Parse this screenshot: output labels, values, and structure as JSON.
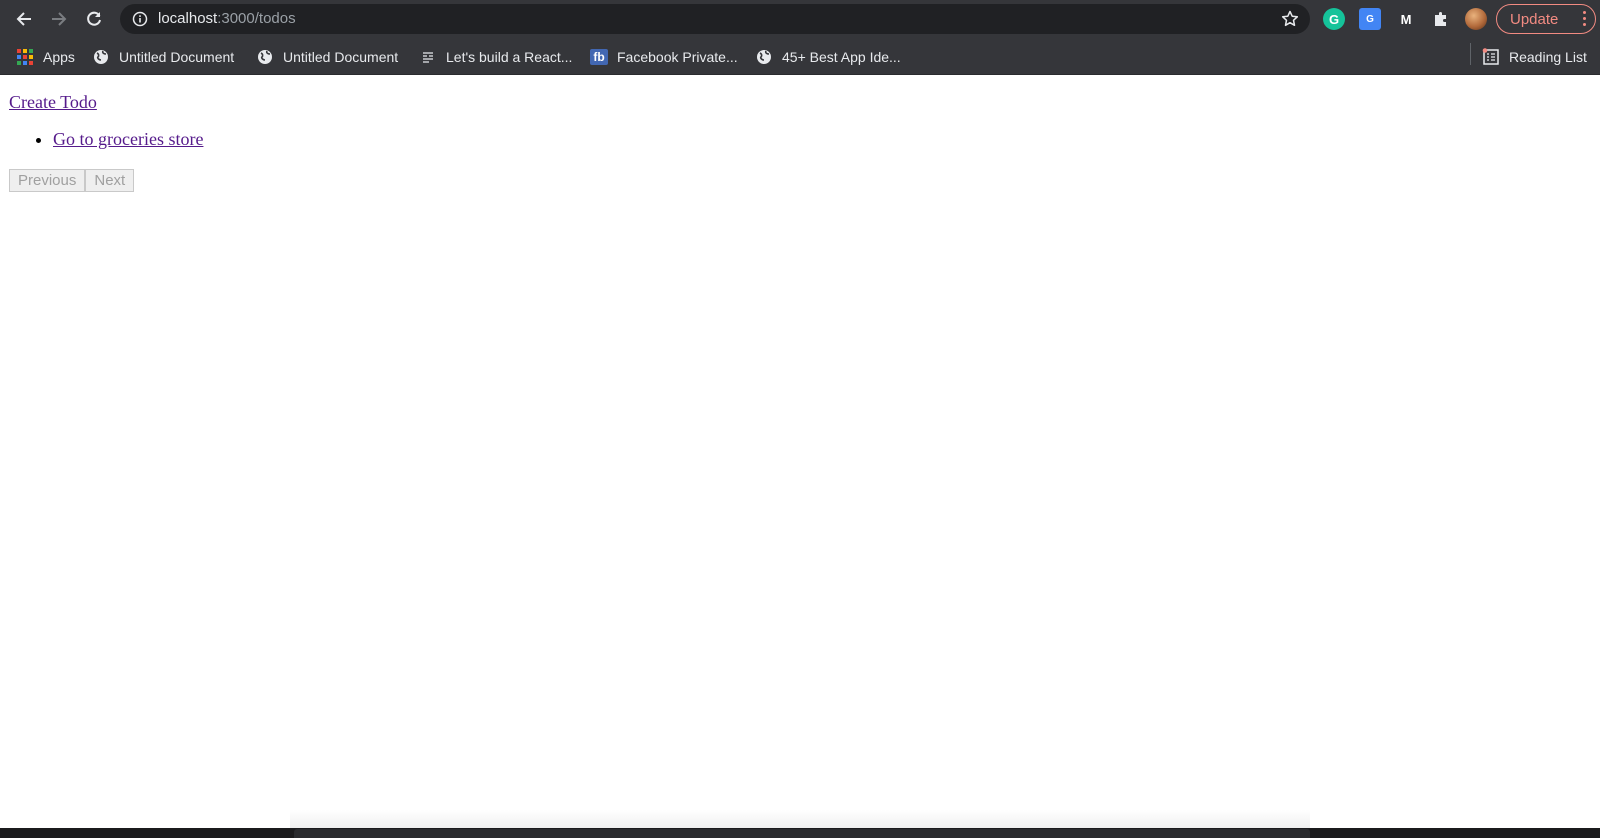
{
  "browser": {
    "url_host": "localhost",
    "url_path": ":3000/todos",
    "update_label": "Update",
    "bookmarks": [
      {
        "label": "Apps",
        "icon": "apps-grid-icon"
      },
      {
        "label": "Untitled Document",
        "icon": "globe-icon"
      },
      {
        "label": "Untitled Document",
        "icon": "globe-icon"
      },
      {
        "label": "Let's build a React...",
        "icon": "list-icon"
      },
      {
        "label": "Facebook Private...",
        "icon": "facebook-icon"
      },
      {
        "label": "45+ Best App Ide...",
        "icon": "globe-icon"
      }
    ],
    "reading_list_label": "Reading List",
    "extensions": [
      "grammarly-icon",
      "google-translate-icon",
      "medium-icon",
      "puzzle-icon",
      "avatar"
    ],
    "colors": {
      "update_accent": "#f28b82",
      "link": "#551a8b",
      "chrome_bg": "#35363a"
    }
  },
  "page": {
    "create_link": "Create Todo",
    "todos": [
      "Go to groceries store"
    ],
    "pagination": {
      "previous": "Previous",
      "next": "Next"
    }
  }
}
